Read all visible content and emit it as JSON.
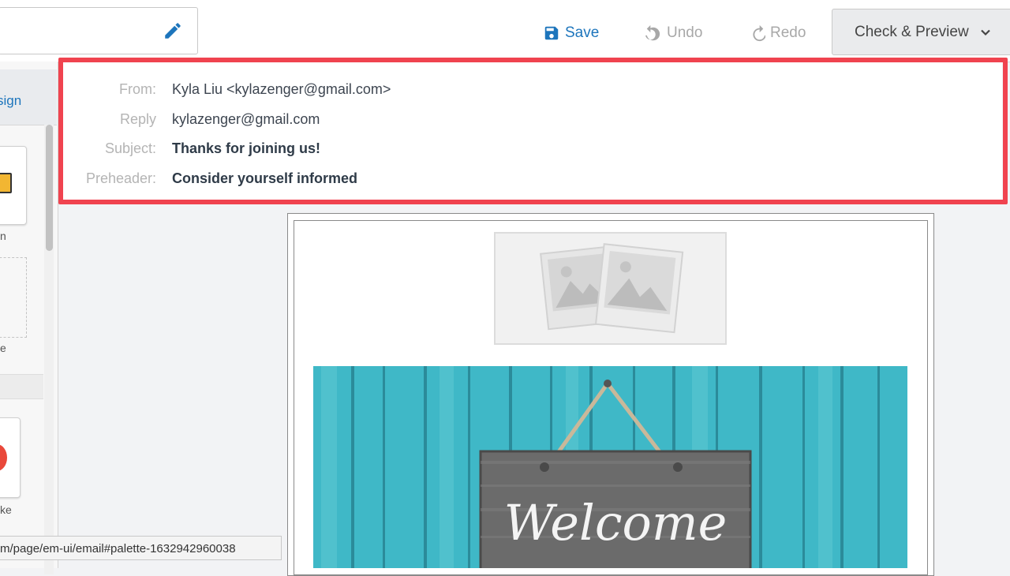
{
  "toolbar": {
    "save_label": "Save",
    "undo_label": "Undo",
    "redo_label": "Redo",
    "check_preview_label": "Check & Preview"
  },
  "sidebar": {
    "tab_label": "sign",
    "palette_labels": [
      "n",
      "e",
      "ke"
    ]
  },
  "email_header": {
    "from_label": "From:",
    "from_value": "Kyla Liu <kylazenger@gmail.com>",
    "reply_label": "Reply",
    "reply_value": "kylazenger@gmail.com",
    "subject_label": "Subject:",
    "subject_value": "Thanks for joining us!",
    "preheader_label": "Preheader:",
    "preheader_value": "Consider yourself informed"
  },
  "hero_image": {
    "sign_text": "Welcome"
  },
  "status_url": "m/page/em-ui/email#palette-1632942960038",
  "colors": {
    "accent": "#1d75bc",
    "highlight": "#f0434f",
    "wood": "#3fb8c7"
  }
}
